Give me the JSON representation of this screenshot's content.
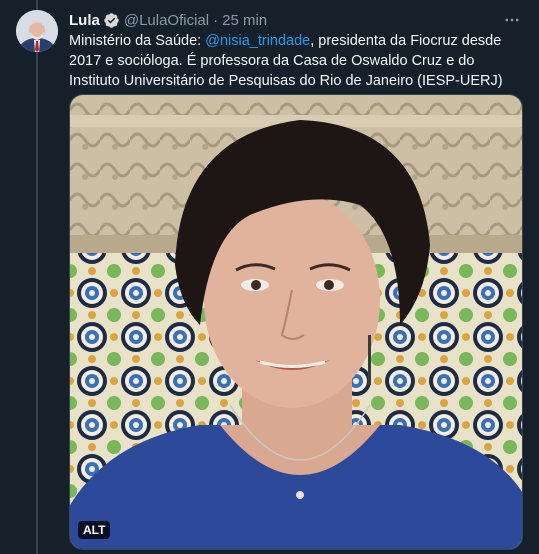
{
  "tweet": {
    "author_name": "Lula",
    "handle": "@LulaOficial",
    "separator": "·",
    "time": "25 min",
    "text_before_mention": "Ministério da Saúde: ",
    "mention": "@nisia_trindade",
    "text_after_mention": ", presidenta da Fiocruz desde 2017 e socióloga. É professora da Casa de Oswaldo Cruz e do Instituto Universitário de Pesquisas do Rio de Janeiro (IESP-UERJ)"
  },
  "media": {
    "alt_badge": "ALT"
  },
  "icons": {
    "verified": "verified-badge-icon",
    "more": "more-horizontal-icon"
  },
  "colors": {
    "background": "#15202b",
    "link": "#1d9bf0",
    "muted": "#8b98a5",
    "text": "#f7f9f9"
  }
}
